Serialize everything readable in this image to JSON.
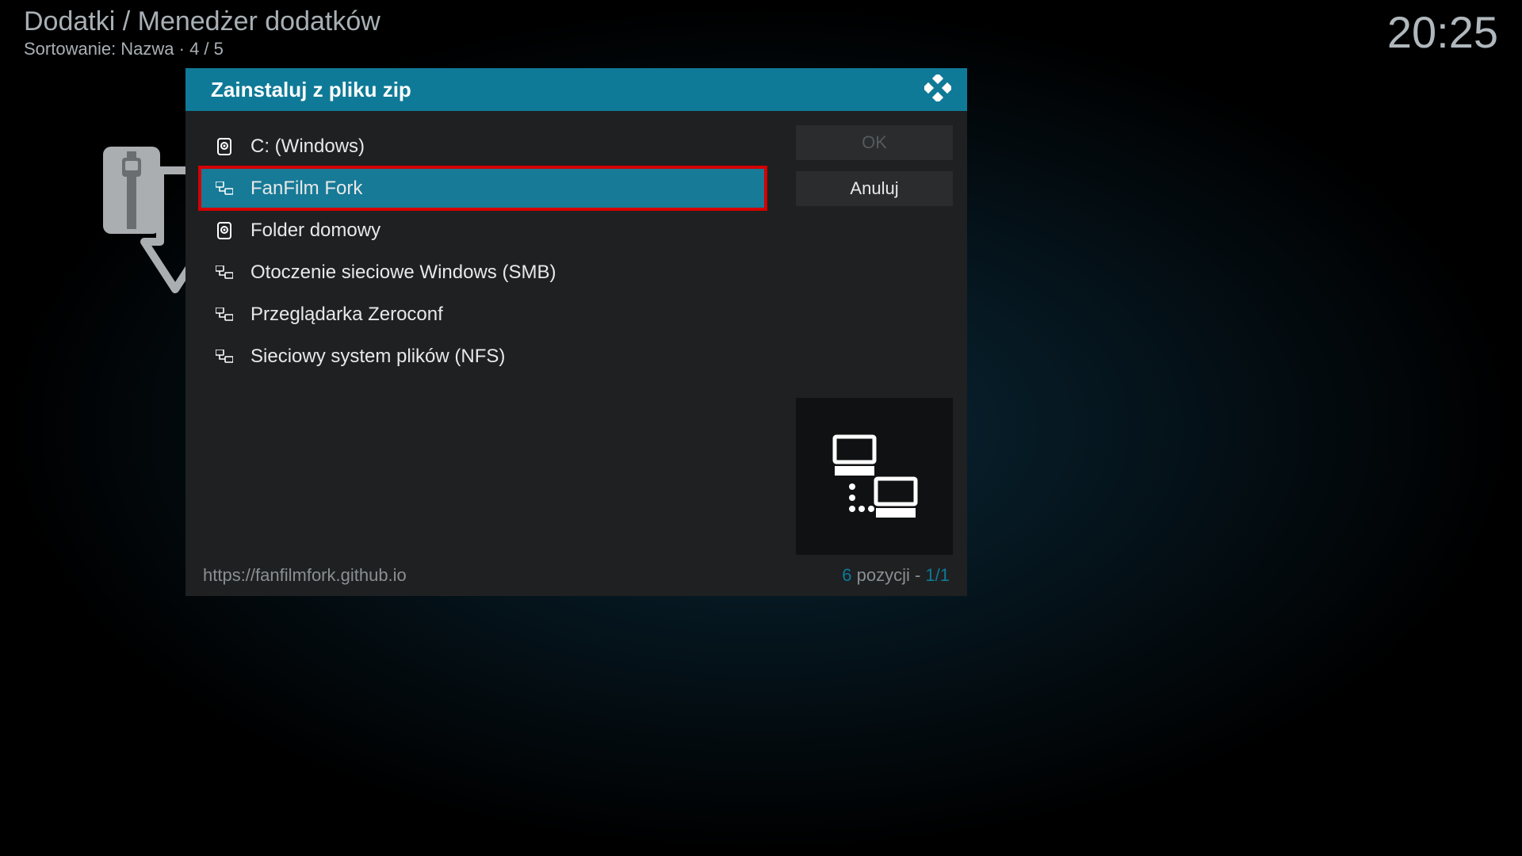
{
  "header": {
    "breadcrumb": "Dodatki / Menedżer dodatków",
    "sort_line": "Sortowanie: Nazwa  ·  4 / 5",
    "clock": "20:25"
  },
  "dialog": {
    "title": "Zainstaluj z pliku zip",
    "items": [
      {
        "icon": "hdd",
        "label": "C: (Windows)"
      },
      {
        "icon": "network",
        "label": "FanFilm Fork",
        "selected": true
      },
      {
        "icon": "hdd",
        "label": "Folder domowy"
      },
      {
        "icon": "network",
        "label": "Otoczenie sieciowe Windows (SMB)"
      },
      {
        "icon": "network",
        "label": "Przeglądarka Zeroconf"
      },
      {
        "icon": "network",
        "label": "Sieciowy system plików (NFS)"
      }
    ],
    "ok_label": "OK",
    "cancel_label": "Anuluj"
  },
  "footer": {
    "path": "https://fanfilmfork.github.io",
    "count_number": "6",
    "count_word": " pozycji - ",
    "page": "1/1"
  }
}
